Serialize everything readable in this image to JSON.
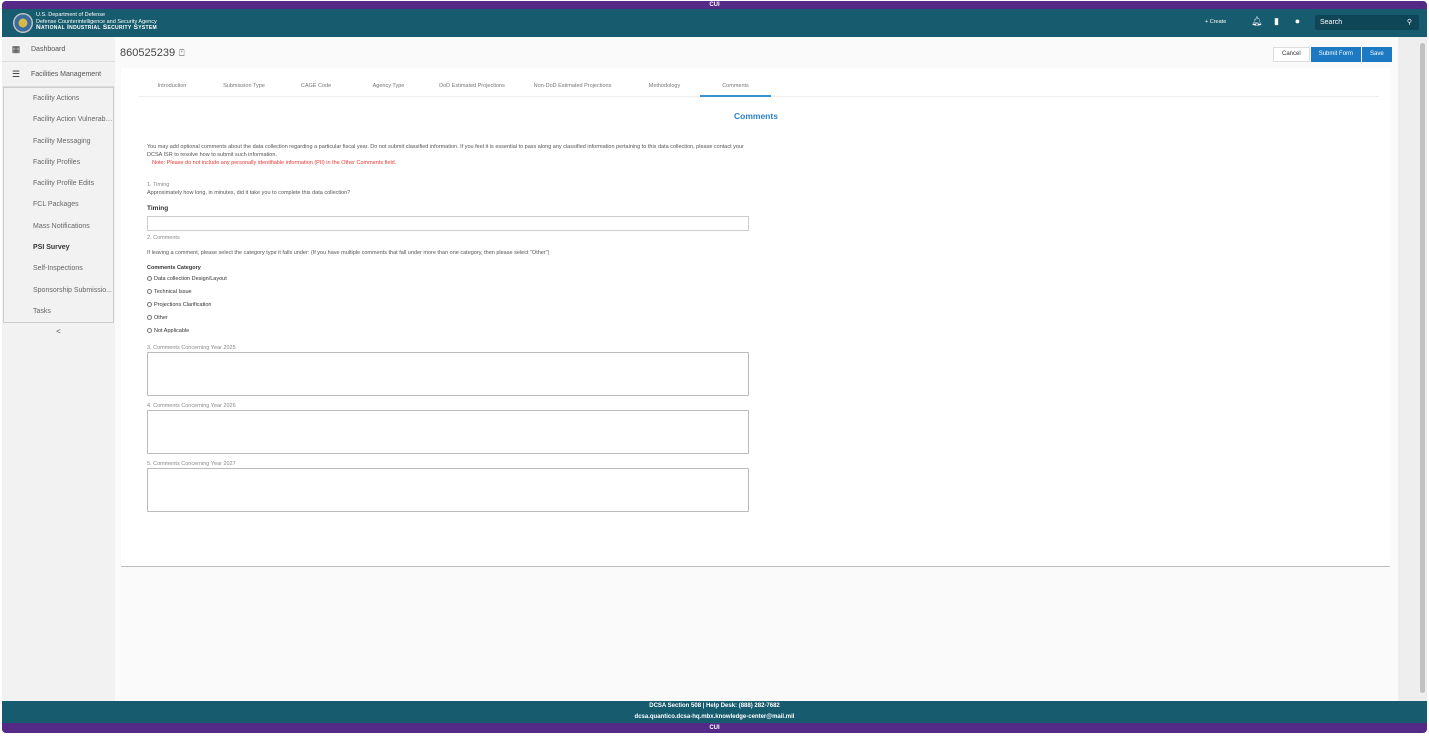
{
  "banner": {
    "classification": "CUI"
  },
  "header": {
    "line1": "U.S. Department of Defense",
    "line2": "Defense Counterintelligence and Security Agency",
    "line3": "National Industrial Security System",
    "create": "+ Create",
    "search_placeholder": "Search"
  },
  "sidebar": {
    "dashboard": "Dashboard",
    "facilities": "Facilities Management",
    "items": [
      "Facility Actions",
      "Facility Action Vulnerabil...",
      "Facility Messaging",
      "Facility Profiles",
      "Facility Profile Edits",
      "FCL Packages",
      "Mass Notifications",
      "PSI Survey",
      "Self-Inspections",
      "Sponsorship Submissio...",
      "Tasks"
    ],
    "active": "PSI Survey",
    "collapse": "<"
  },
  "page": {
    "title": "860525239",
    "cancel": "Cancel",
    "submit": "Submit Form",
    "save": "Save"
  },
  "tabs": [
    "Introduction",
    "Submission Type",
    "CAGE Code",
    "Agency Type",
    "DoD Estimated Projections",
    "Non-DoD Estimated Projections",
    "Methodology",
    "Comments"
  ],
  "form": {
    "section_title": "Comments",
    "intro": "You may add optional comments about the data collection regarding a particular fiscal year. Do not submit classified information. If you feel it is essential to pass along any classified information pertaining to this data collection, please contact your DCSA ISR to resolve how to submit such information.",
    "note": "Note: Please do not include any personally identifiable information (PII) in the Other Comments field.",
    "q1": "1. Timing",
    "q1_text": "Approximately how long, in minutes, did it take you to complete this data collection?",
    "timing_label": "Timing",
    "timing_value": "",
    "q2": "2. Comments",
    "q2_text": "If leaving a comment, please select the category type it falls under: (If you have multiple comments that fall under more than one category, then please select \"Other\")",
    "category_label": "Comments Category",
    "categories": [
      "Data collection Design/Layout",
      "Technical Issue",
      "Projections Clarification",
      "Other",
      "Not Applicable"
    ],
    "q3": "3. Comments Concerning Year 2025",
    "q4": "4. Comments Concerning Year 2026",
    "q5": "5. Comments Concerning Year 2027"
  },
  "footer": {
    "line1": "DCSA Section 508 | Help Desk: (888) 282-7682",
    "line2": "dcsa.quantico.dcsa-hq.mbx.knowledge-center@mail.mil"
  }
}
